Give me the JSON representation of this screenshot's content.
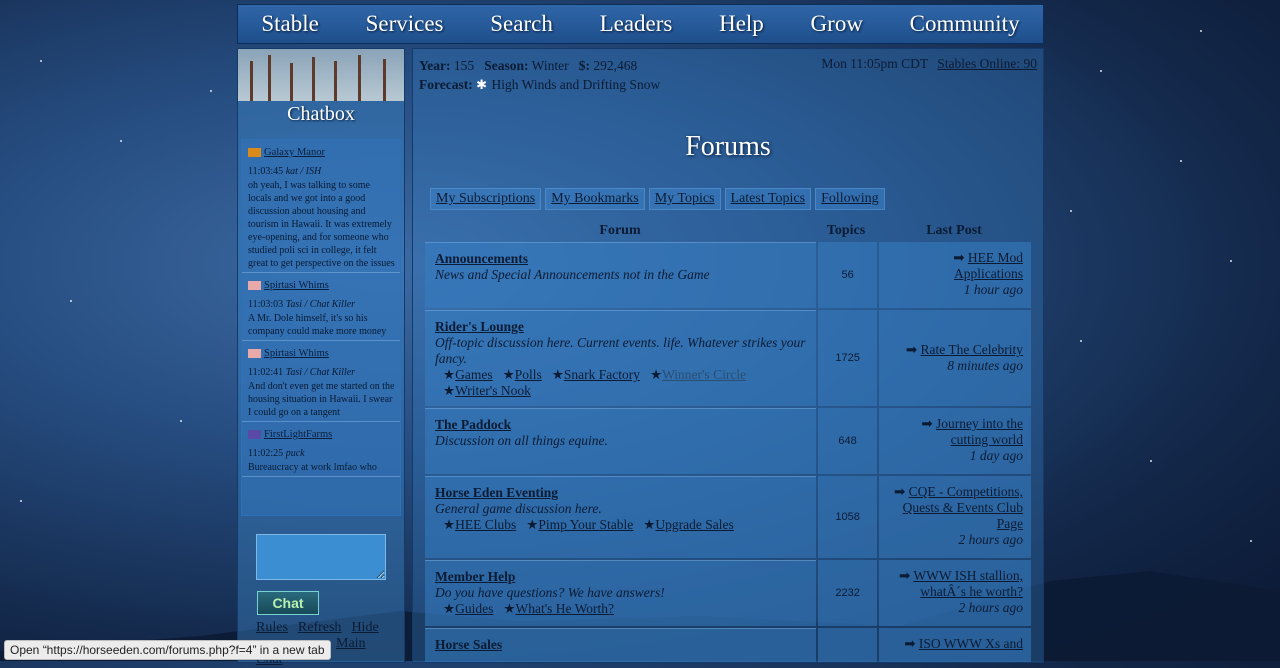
{
  "nav": [
    "Stable",
    "Services",
    "Search",
    "Leaders",
    "Help",
    "Grow",
    "Community"
  ],
  "chatbox": {
    "title": "Chatbox",
    "messages": [
      {
        "user": "Galaxy Manor",
        "flag_color": "#d98a1a",
        "time": "11:03:45",
        "meta": "kat / ISH",
        "text": "oh yeah, I was talking to some locals and we got into a good discussion about housing and tourism in Hawaii. It was extremely eye-opening, and for someone who studied poli sci in college, it felt great to get perspective on the issues"
      },
      {
        "user": "Spirtasi Whims",
        "flag_color": "#e9a9a9",
        "time": "11:03:03",
        "meta": "Tasi / Chat Killer",
        "text": "A Mr. Dole himself, it's so his company could make more money"
      },
      {
        "user": "Spirtasi Whims",
        "flag_color": "#e9a9a9",
        "time": "11:02:41",
        "meta": "Tasi / Chat Killer",
        "text": "And don't even get me started on the housing situation in Hawaii. I swear I could go on a tangent"
      },
      {
        "user": "FirstLightFarms",
        "flag_color": "#5a4aa8",
        "time": "11:02:25",
        "meta": "puck",
        "text": "Bureaucracy at work lmfao who"
      }
    ],
    "chat_button": "Chat",
    "links": [
      "Rules",
      "Refresh",
      "Hide"
    ],
    "links2": "Main Chat"
  },
  "info": {
    "year_label": "Year:",
    "year": "155",
    "season_label": "Season:",
    "season": "Winter",
    "money_label": "$:",
    "money": "292,468",
    "forecast_label": "Forecast:",
    "forecast": "High Winds and Drifting Snow",
    "time": "Mon 11:05pm CDT",
    "online": "Stables Online: 90"
  },
  "page_title": "Forums",
  "tabs": [
    "My Subscriptions",
    "My Bookmarks",
    "My Topics",
    "Latest Topics",
    "Following"
  ],
  "table": {
    "headers": {
      "forum": "Forum",
      "topics": "Topics",
      "last_post": "Last Post"
    },
    "rows": [
      {
        "name": "Announcements",
        "desc": "News and Special Announcements not in the Game",
        "subs": [],
        "topics": "56",
        "last": "HEE Mod Applications",
        "when": "1 hour ago"
      },
      {
        "name": "Rider's Lounge",
        "desc": "Off-topic discussion here. Current events. life. Whatever strikes your fancy.",
        "subs": [
          "Games",
          "Polls",
          "Snark Factory",
          "Winner's Circle",
          "Writer's Nook"
        ],
        "topics": "1725",
        "last": "Rate The Celebrity",
        "when": "8 minutes ago"
      },
      {
        "name": "The Paddock",
        "desc": "Discussion on all things equine.",
        "subs": [],
        "topics": "648",
        "last": "Journey into the cutting world",
        "when": "1 day ago"
      },
      {
        "name": "Horse Eden Eventing",
        "desc": "General game discussion here.",
        "subs": [
          "HEE Clubs",
          "Pimp Your Stable",
          "Upgrade Sales"
        ],
        "topics": "1058",
        "last": "CQE - Competitions, Quests & Events Club Page",
        "when": "2 hours ago"
      },
      {
        "name": "Member Help",
        "desc": "Do you have questions? We have answers!",
        "subs": [
          "Guides",
          "What's He Worth?"
        ],
        "topics": "2232",
        "last": "WWW ISH stallion, whatÂ´s he worth?",
        "when": "2 hours ago"
      },
      {
        "name": "Horse Sales",
        "desc": "",
        "subs": [],
        "topics": "",
        "last": "ISO WWW Xs and",
        "when": ""
      }
    ]
  },
  "status_url": "Open “https://horseeden.com/forums.php?f=4” in a new tab"
}
